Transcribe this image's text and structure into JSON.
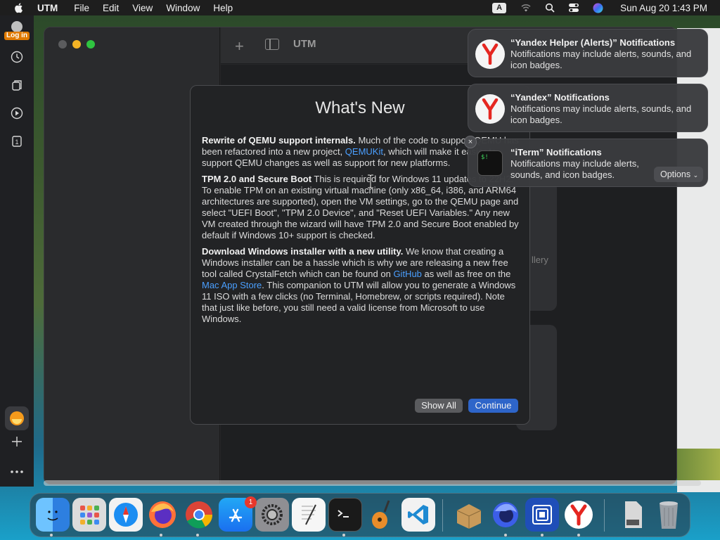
{
  "menubar": {
    "app_name": "UTM",
    "items": [
      "File",
      "Edit",
      "View",
      "Window",
      "Help"
    ],
    "input_source": "A",
    "clock": "Sun Aug 20  1:43 PM"
  },
  "left_strip": {
    "login_label": "Log in",
    "badge_number": "1"
  },
  "utm_window": {
    "toolbar_title": "UTM",
    "bg_card_label": "llery"
  },
  "dialog": {
    "title": "What's New",
    "sections": [
      {
        "heading": "Rewrite of QEMU support internals.",
        "text_before": " Much of the code to support QEMU has been refactored into a new project, ",
        "link": "QEMUKit",
        "text_after": ", which will make it easier to support QEMU changes as well as support for new platforms."
      },
      {
        "heading": "TPM 2.0 and Secure Boot",
        "text": " This is required for Windows 11 updates to 22H2. To enable TPM on an existing virtual machine (only x86_64, i386, and ARM64 architectures are supported), open the VM settings, go to the QEMU page and select \"UEFI Boot\", \"TPM 2.0 Device\", and \"Reset UEFI Variables.\" Any new VM created through the wizard will have TPM 2.0 and Secure Boot enabled by default if Windows 10+ support is checked."
      },
      {
        "heading": "Download Windows installer with a new utility.",
        "text_1": " We know that creating a Windows installer can be a hassle which is why we are releasing a new free tool called CrystalFetch which can be found on ",
        "link_1": "GitHub",
        "text_2": " as well as free on the ",
        "link_2": "Mac App Store",
        "text_3": ". This companion to UTM will allow you to generate a Windows 11 ISO with a few clicks (no Terminal, Homebrew, or scripts required). Note that just like before, you still need a valid license from Microsoft to use Windows."
      }
    ],
    "show_all_label": "Show All",
    "continue_label": "Continue"
  },
  "notifications": [
    {
      "title": "“Yandex Helper (Alerts)” Notifications",
      "text": "Notifications may include alerts, sounds, and icon badges.",
      "icon": "yandex-icon"
    },
    {
      "title": "“Yandex” Notifications",
      "text": "Notifications may include alerts, sounds, and icon badges.",
      "icon": "yandex-icon"
    },
    {
      "title": "“iTerm” Notifications",
      "text": "Notifications may include alerts, sounds, and icon badges.",
      "icon": "iterm-icon"
    }
  ],
  "notification_close": "×",
  "notification_options": "Options",
  "dock": {
    "apps": [
      "finder-icon",
      "launchpad-icon",
      "safari-icon",
      "firefox-icon",
      "chrome-icon",
      "app-store-icon",
      "system-settings-icon",
      "textedit-icon",
      "terminal-icon",
      "garageband-icon",
      "vscode-icon",
      "archive-utility-icon",
      "firefox-dev-icon",
      "utm-icon",
      "yandex-icon",
      "preview-icon",
      "trash-icon"
    ],
    "settings_badge": "1",
    "colors": {
      "accent": "#2e65c9",
      "yandex_red": "#e52620"
    }
  }
}
